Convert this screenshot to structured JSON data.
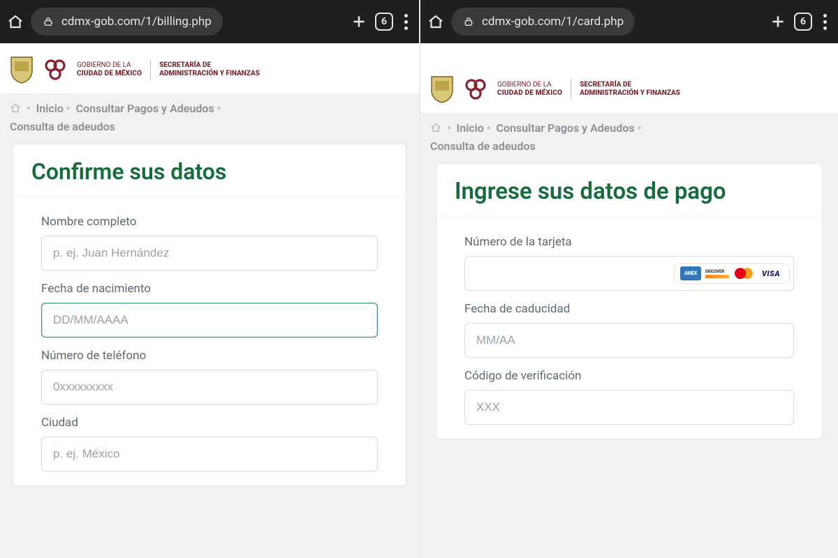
{
  "left": {
    "chrome": {
      "url": "cdmx-gob.com/1/billing.php",
      "tab_count": "6"
    },
    "header": {
      "gov_line1": "GOBIERNO DE LA",
      "gov_line2": "CIUDAD DE MÉXICO",
      "dept_line1": "SECRETARÍA DE",
      "dept_line2": "ADMINISTRACIÓN Y FINANZAS"
    },
    "breadcrumb": {
      "home": "Inicio",
      "level1": "Consultar Pagos y Adeudos",
      "level2": "Consulta de adeudos"
    },
    "card": {
      "title": "Confirme sus datos",
      "fields": {
        "name": {
          "label": "Nombre completo",
          "placeholder": "p. ej. Juan Hernández"
        },
        "dob": {
          "label": "Fecha de nacimiento",
          "placeholder": "DD/MM/AAAA"
        },
        "phone": {
          "label": "Número de teléfono",
          "placeholder": "0xxxxxxxxx"
        },
        "city": {
          "label": "Ciudad",
          "placeholder": "p. ej. México"
        }
      }
    }
  },
  "right": {
    "chrome": {
      "url": "cdmx-gob.com/1/card.php",
      "tab_count": "6"
    },
    "header": {
      "gov_line1": "GOBIERNO DE LA",
      "gov_line2": "CIUDAD DE MÉXICO",
      "dept_line1": "SECRETARÍA DE",
      "dept_line2": "ADMINISTRACIÓN Y FINANZAS"
    },
    "breadcrumb": {
      "home": "Inicio",
      "level1": "Consultar Pagos y Adeudos",
      "level2": "Consulta de adeudos"
    },
    "card": {
      "title": "Ingrese sus datos de pago",
      "fields": {
        "cardnum": {
          "label": "Número de la tarjeta",
          "placeholder": ""
        },
        "expiry": {
          "label": "Fecha de caducidad",
          "placeholder": "MM/AA"
        },
        "cvv": {
          "label": "Código de verificación",
          "placeholder": "XXX"
        }
      },
      "brands": {
        "amex": "AMEX",
        "discover": "DISCOVER",
        "visa": "VISA"
      }
    }
  }
}
